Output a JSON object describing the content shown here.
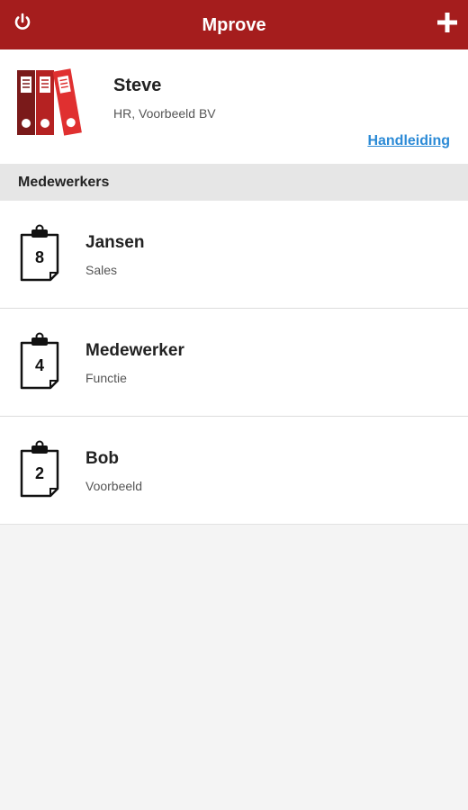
{
  "app_bar": {
    "title": "Mprove",
    "left_icon": "power-icon",
    "right_icon": "plus-icon",
    "color": "#a51d1d"
  },
  "profile": {
    "name": "Steve",
    "organization": "HR, Voorbeeld BV",
    "manual_link": "Handleiding",
    "icon": "binders-icon"
  },
  "section": {
    "label": "Medewerkers"
  },
  "employees": [
    {
      "name": "Jansen",
      "role": "Sales",
      "count": "8"
    },
    {
      "name": "Medewerker",
      "role": "Functie",
      "count": "4"
    },
    {
      "name": "Bob",
      "role": "Voorbeeld",
      "count": "2"
    }
  ],
  "colors": {
    "link": "#2b8ad6",
    "section_bg": "#e6e6e6",
    "page_bg": "#f4f4f4"
  }
}
